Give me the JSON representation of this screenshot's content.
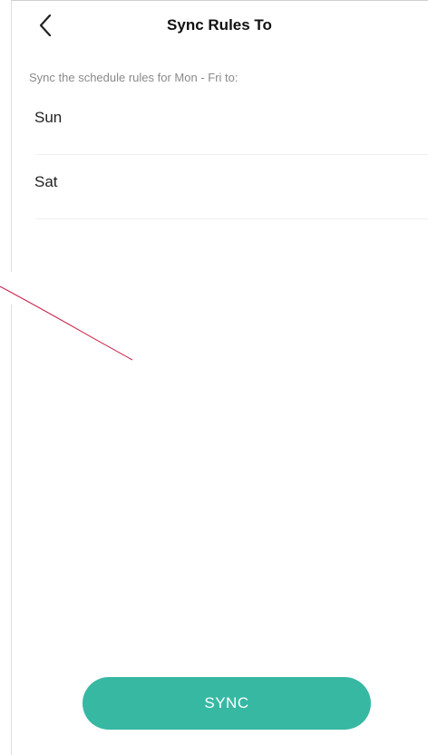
{
  "header": {
    "title": "Sync Rules To",
    "back_icon": "chevron-left-icon"
  },
  "subtitle": "Sync the schedule rules for Mon - Fri to:",
  "days": [
    {
      "label": "Sun"
    },
    {
      "label": "Sat"
    }
  ],
  "sync_button": {
    "label": "SYNC"
  },
  "colors": {
    "accent": "#37b8a3",
    "annotation_line": "#c8234a",
    "subtitle_text": "#8a8a8a",
    "divider": "#eeeeee"
  }
}
